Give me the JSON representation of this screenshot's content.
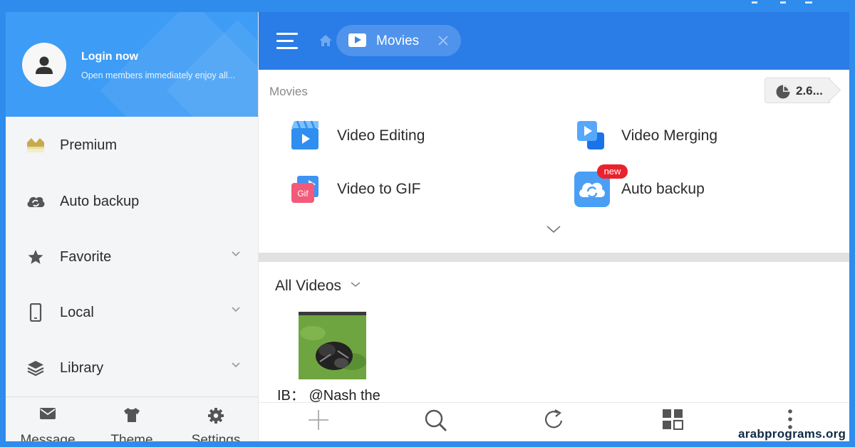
{
  "drawer": {
    "profile": {
      "title": "Login now",
      "subtitle": "Open members immediately enjoy all..."
    },
    "menu": [
      {
        "label": "Premium",
        "icon": "crown-icon",
        "expandable": false
      },
      {
        "label": "Auto backup",
        "icon": "cloud-sync-icon",
        "expandable": false
      },
      {
        "label": "Favorite",
        "icon": "star-icon",
        "expandable": true
      },
      {
        "label": "Local",
        "icon": "phone-icon",
        "expandable": true
      },
      {
        "label": "Library",
        "icon": "layers-icon",
        "expandable": true
      }
    ],
    "bottom": [
      {
        "label": "Message",
        "icon": "envelope-icon"
      },
      {
        "label": "Theme",
        "icon": "shirt-icon"
      },
      {
        "label": "Settings",
        "icon": "gear-icon"
      }
    ]
  },
  "topbar": {
    "tab_label": "Movies"
  },
  "main": {
    "section_title": "Movies",
    "storage_value": "2.6...",
    "tools": [
      {
        "label": "Video Editing",
        "icon": "video-editing-icon"
      },
      {
        "label": "Video Merging",
        "icon": "video-merging-icon"
      },
      {
        "label": "Video to GIF",
        "icon": "gif-icon",
        "icon_text": "Gif"
      },
      {
        "label": "Auto backup",
        "icon": "auto-backup-icon",
        "badge": "new"
      }
    ],
    "all_videos_label": "All Videos",
    "video": {
      "caption": "IB： @Nash the"
    }
  },
  "bottom_bar": [
    "plus-icon",
    "search-icon",
    "refresh-icon",
    "grid-view-icon",
    "more-vertical-icon"
  ],
  "watermark": "arabprograms.org",
  "colors": {
    "frame_blue": "#2f8cec",
    "topbar_blue": "#2a7ce6",
    "profile_blue": "#3d9cf5",
    "badge_red": "#e8232d"
  }
}
